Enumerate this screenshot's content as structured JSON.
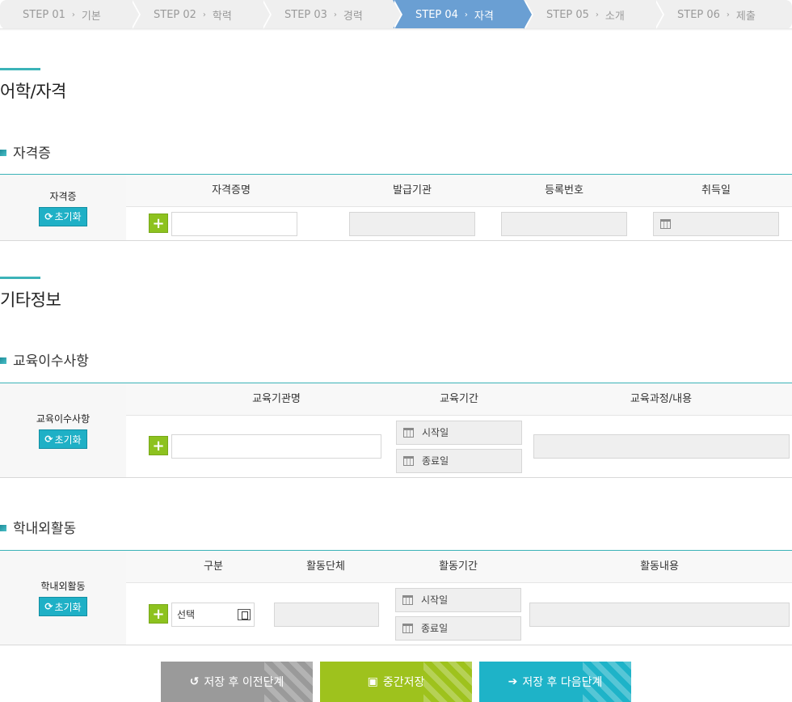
{
  "steps": [
    {
      "num": "STEP 01",
      "label": "기본"
    },
    {
      "num": "STEP 02",
      "label": "학력"
    },
    {
      "num": "STEP 03",
      "label": "경력"
    },
    {
      "num": "STEP 04",
      "label": "자격"
    },
    {
      "num": "STEP 05",
      "label": "소개"
    },
    {
      "num": "STEP 06",
      "label": "제출"
    }
  ],
  "step_separator": "›",
  "active_step": "STEP 04",
  "section1": {
    "title": "어학/자격",
    "sub": "자격증",
    "side_label": "자격증",
    "reset": "초기화",
    "headers": [
      "자격증명",
      "발급기관",
      "등록번호",
      "취득일"
    ]
  },
  "section2": {
    "title": "기타정보",
    "edu": {
      "sub": "교육이수사항",
      "side_label": "교육이수사항",
      "reset": "초기화",
      "headers": [
        "교육기관명",
        "교육기간",
        "교육과정/내용"
      ],
      "start_placeholder": "시작일",
      "end_placeholder": "종료일"
    },
    "act": {
      "sub": "학내외활동",
      "side_label": "학내외활동",
      "reset": "초기화",
      "headers": [
        "구분",
        "활동단체",
        "활동기간",
        "활동내용"
      ],
      "select_value": "선택",
      "start_placeholder": "시작일",
      "end_placeholder": "종료일"
    }
  },
  "buttons": {
    "prev": "저장 후 이전단계",
    "save": "중간저장",
    "next": "저장 후 다음단계"
  },
  "colors": {
    "accent": "#3bb3b8",
    "active_step": "#6a9fd3",
    "plus": "#8dc21f",
    "reset": "#1fb0c6",
    "prev_btn": "#9a9a9a",
    "save_btn": "#9ec21d",
    "next_btn": "#1eb3c8"
  }
}
